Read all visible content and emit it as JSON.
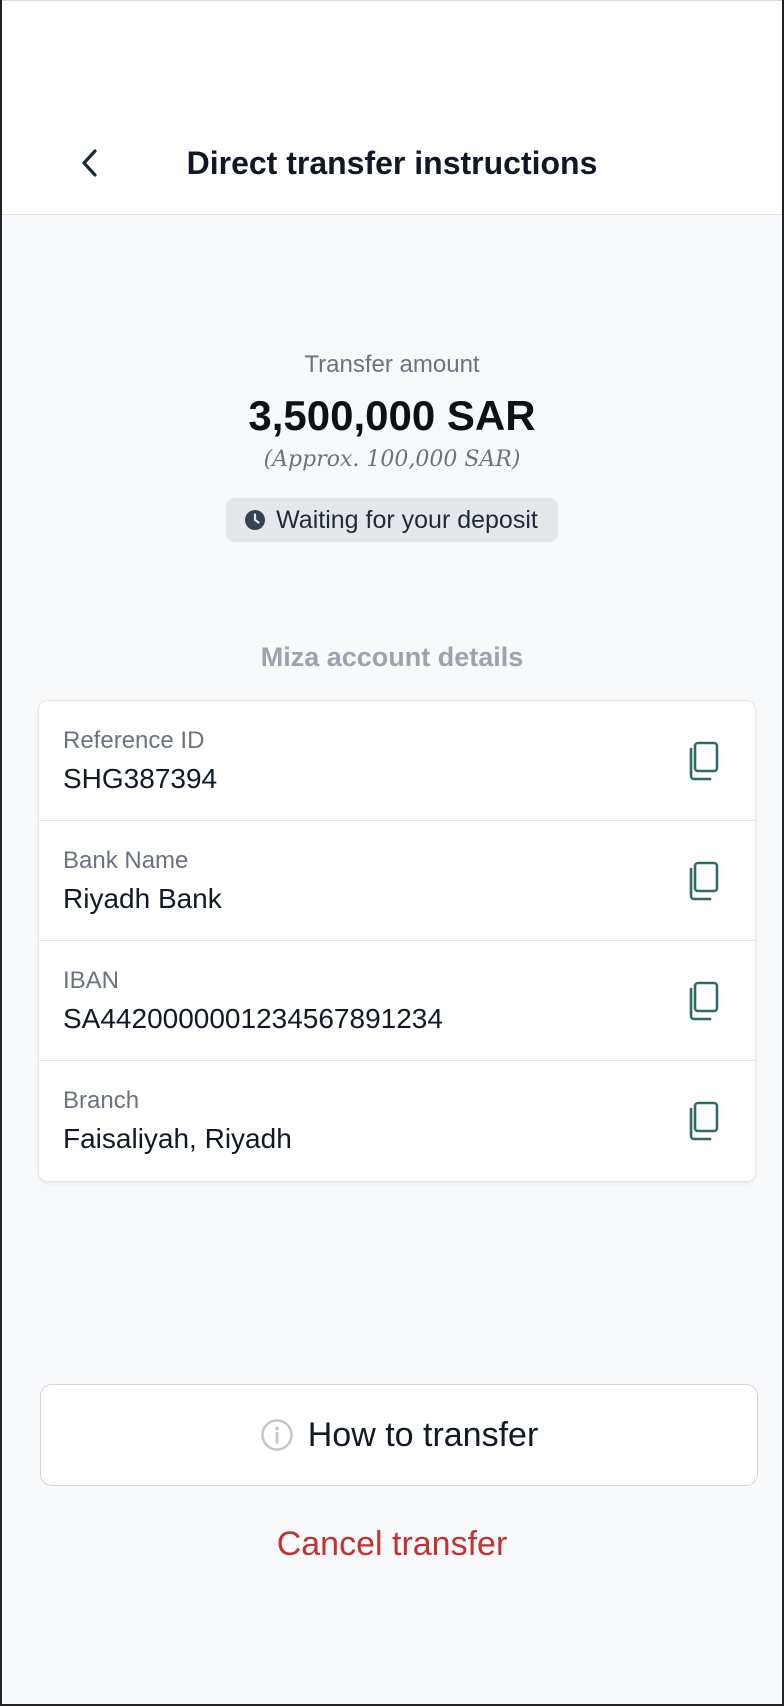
{
  "header": {
    "title": "Direct transfer instructions",
    "back_icon": "chevron-left-icon"
  },
  "summary": {
    "amount_label": "Transfer amount",
    "amount_value": "3,500,000 SAR",
    "approx_text": "(Approx. 100,000 SAR)",
    "status_text": "Waiting for your deposit",
    "status_icon": "clock-icon"
  },
  "account": {
    "section_title": "Miza account details",
    "rows": [
      {
        "label": "Reference ID",
        "value": "SHG387394"
      },
      {
        "label": "Bank Name",
        "value": "Riyadh Bank"
      },
      {
        "label": "IBAN",
        "value": "SA4420000001234567891234"
      },
      {
        "label": "Branch",
        "value": "Faisaliyah, Riyadh"
      }
    ],
    "copy_icon": "copy-icon"
  },
  "actions": {
    "how_to_label": "How to transfer",
    "how_to_icon": "info-icon",
    "cancel_label": "Cancel transfer"
  },
  "colors": {
    "accent_teal": "#2f6b63",
    "danger": "#c53030",
    "background": "#f7f9fa"
  }
}
